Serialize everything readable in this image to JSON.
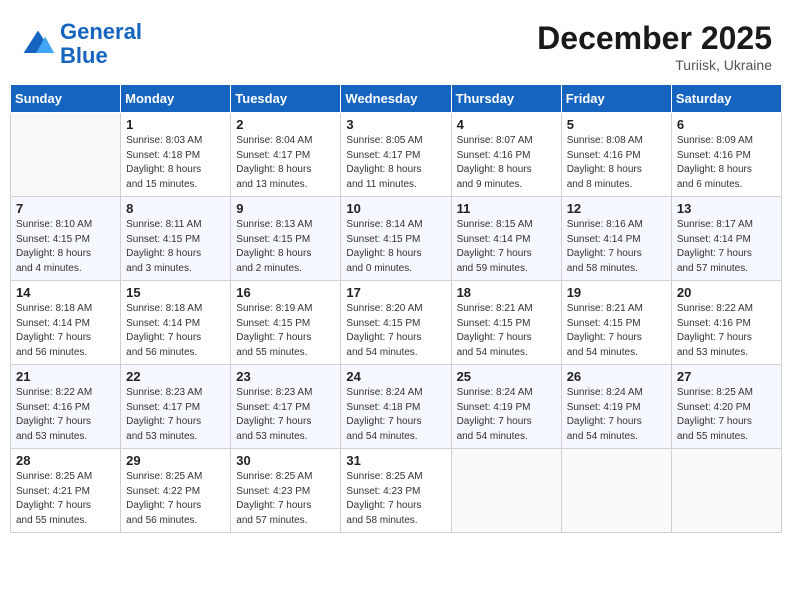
{
  "header": {
    "logo_line1": "General",
    "logo_line2": "Blue",
    "month": "December 2025",
    "location": "Turiisk, Ukraine"
  },
  "weekdays": [
    "Sunday",
    "Monday",
    "Tuesday",
    "Wednesday",
    "Thursday",
    "Friday",
    "Saturday"
  ],
  "weeks": [
    [
      {
        "day": "",
        "info": ""
      },
      {
        "day": "1",
        "info": "Sunrise: 8:03 AM\nSunset: 4:18 PM\nDaylight: 8 hours\nand 15 minutes."
      },
      {
        "day": "2",
        "info": "Sunrise: 8:04 AM\nSunset: 4:17 PM\nDaylight: 8 hours\nand 13 minutes."
      },
      {
        "day": "3",
        "info": "Sunrise: 8:05 AM\nSunset: 4:17 PM\nDaylight: 8 hours\nand 11 minutes."
      },
      {
        "day": "4",
        "info": "Sunrise: 8:07 AM\nSunset: 4:16 PM\nDaylight: 8 hours\nand 9 minutes."
      },
      {
        "day": "5",
        "info": "Sunrise: 8:08 AM\nSunset: 4:16 PM\nDaylight: 8 hours\nand 8 minutes."
      },
      {
        "day": "6",
        "info": "Sunrise: 8:09 AM\nSunset: 4:16 PM\nDaylight: 8 hours\nand 6 minutes."
      }
    ],
    [
      {
        "day": "7",
        "info": "Sunrise: 8:10 AM\nSunset: 4:15 PM\nDaylight: 8 hours\nand 4 minutes."
      },
      {
        "day": "8",
        "info": "Sunrise: 8:11 AM\nSunset: 4:15 PM\nDaylight: 8 hours\nand 3 minutes."
      },
      {
        "day": "9",
        "info": "Sunrise: 8:13 AM\nSunset: 4:15 PM\nDaylight: 8 hours\nand 2 minutes."
      },
      {
        "day": "10",
        "info": "Sunrise: 8:14 AM\nSunset: 4:15 PM\nDaylight: 8 hours\nand 0 minutes."
      },
      {
        "day": "11",
        "info": "Sunrise: 8:15 AM\nSunset: 4:14 PM\nDaylight: 7 hours\nand 59 minutes."
      },
      {
        "day": "12",
        "info": "Sunrise: 8:16 AM\nSunset: 4:14 PM\nDaylight: 7 hours\nand 58 minutes."
      },
      {
        "day": "13",
        "info": "Sunrise: 8:17 AM\nSunset: 4:14 PM\nDaylight: 7 hours\nand 57 minutes."
      }
    ],
    [
      {
        "day": "14",
        "info": "Sunrise: 8:18 AM\nSunset: 4:14 PM\nDaylight: 7 hours\nand 56 minutes."
      },
      {
        "day": "15",
        "info": "Sunrise: 8:18 AM\nSunset: 4:14 PM\nDaylight: 7 hours\nand 56 minutes."
      },
      {
        "day": "16",
        "info": "Sunrise: 8:19 AM\nSunset: 4:15 PM\nDaylight: 7 hours\nand 55 minutes."
      },
      {
        "day": "17",
        "info": "Sunrise: 8:20 AM\nSunset: 4:15 PM\nDaylight: 7 hours\nand 54 minutes."
      },
      {
        "day": "18",
        "info": "Sunrise: 8:21 AM\nSunset: 4:15 PM\nDaylight: 7 hours\nand 54 minutes."
      },
      {
        "day": "19",
        "info": "Sunrise: 8:21 AM\nSunset: 4:15 PM\nDaylight: 7 hours\nand 54 minutes."
      },
      {
        "day": "20",
        "info": "Sunrise: 8:22 AM\nSunset: 4:16 PM\nDaylight: 7 hours\nand 53 minutes."
      }
    ],
    [
      {
        "day": "21",
        "info": "Sunrise: 8:22 AM\nSunset: 4:16 PM\nDaylight: 7 hours\nand 53 minutes."
      },
      {
        "day": "22",
        "info": "Sunrise: 8:23 AM\nSunset: 4:17 PM\nDaylight: 7 hours\nand 53 minutes."
      },
      {
        "day": "23",
        "info": "Sunrise: 8:23 AM\nSunset: 4:17 PM\nDaylight: 7 hours\nand 53 minutes."
      },
      {
        "day": "24",
        "info": "Sunrise: 8:24 AM\nSunset: 4:18 PM\nDaylight: 7 hours\nand 54 minutes."
      },
      {
        "day": "25",
        "info": "Sunrise: 8:24 AM\nSunset: 4:19 PM\nDaylight: 7 hours\nand 54 minutes."
      },
      {
        "day": "26",
        "info": "Sunrise: 8:24 AM\nSunset: 4:19 PM\nDaylight: 7 hours\nand 54 minutes."
      },
      {
        "day": "27",
        "info": "Sunrise: 8:25 AM\nSunset: 4:20 PM\nDaylight: 7 hours\nand 55 minutes."
      }
    ],
    [
      {
        "day": "28",
        "info": "Sunrise: 8:25 AM\nSunset: 4:21 PM\nDaylight: 7 hours\nand 55 minutes."
      },
      {
        "day": "29",
        "info": "Sunrise: 8:25 AM\nSunset: 4:22 PM\nDaylight: 7 hours\nand 56 minutes."
      },
      {
        "day": "30",
        "info": "Sunrise: 8:25 AM\nSunset: 4:23 PM\nDaylight: 7 hours\nand 57 minutes."
      },
      {
        "day": "31",
        "info": "Sunrise: 8:25 AM\nSunset: 4:23 PM\nDaylight: 7 hours\nand 58 minutes."
      },
      {
        "day": "",
        "info": ""
      },
      {
        "day": "",
        "info": ""
      },
      {
        "day": "",
        "info": ""
      }
    ]
  ]
}
